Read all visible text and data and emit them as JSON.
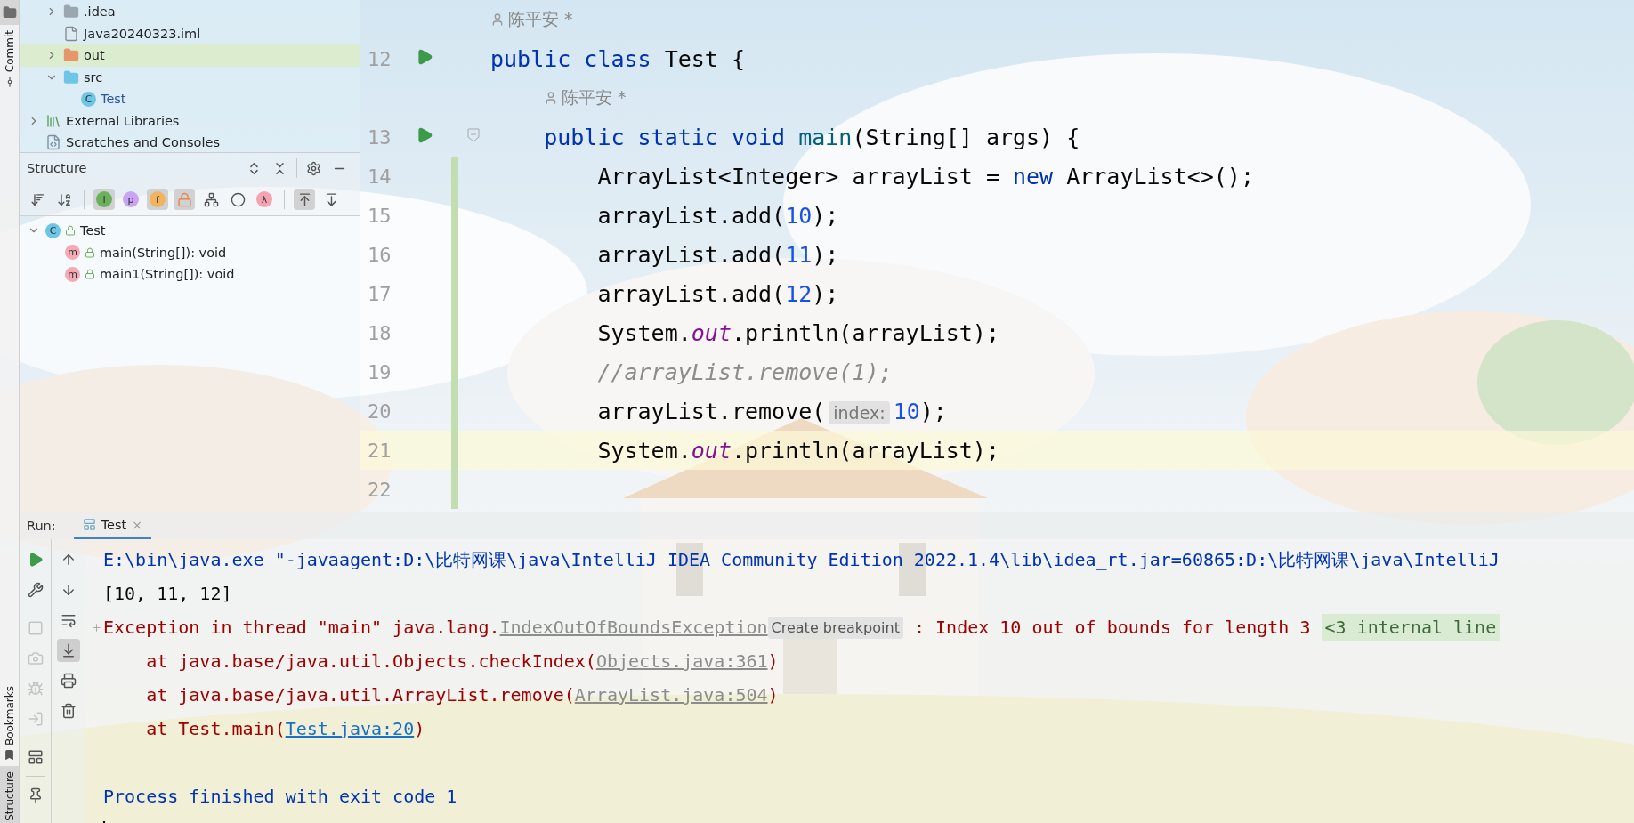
{
  "left_strip": {
    "items": [
      {
        "kind": "project",
        "selected": true
      },
      {
        "kind": "commit",
        "label": "Commit",
        "selected": false
      },
      {
        "kind": "bookmarks",
        "label": "Bookmarks",
        "selected": false
      },
      {
        "kind": "structure",
        "label": "Structure",
        "selected": true
      }
    ]
  },
  "project_tree": {
    "items": [
      {
        "children": [
          {
            "label": ".idea",
            "kind": "folder",
            "expanded": false,
            "selected": false
          },
          {
            "label": "Java20240323.iml",
            "kind": "file",
            "selected": false
          },
          {
            "label": "out",
            "kind": "excluded-folder",
            "expanded": false,
            "selected": true
          },
          {
            "label": "src",
            "kind": "source-folder",
            "expanded": true,
            "selected": false,
            "children": [
              {
                "label": "Test",
                "kind": "class",
                "badge": "C",
                "modified": true,
                "selected": false
              }
            ]
          }
        ]
      },
      {
        "label": "External Libraries",
        "kind": "library",
        "expanded": false,
        "selected": false
      },
      {
        "label": "Scratches and Consoles",
        "kind": "scratch",
        "selected": false
      }
    ]
  },
  "structure": {
    "title": "Structure",
    "header_actions": [
      {
        "kind": "expand-all"
      },
      {
        "kind": "collapse-all"
      },
      {
        "kind": "separator"
      },
      {
        "kind": "settings"
      },
      {
        "kind": "minimize"
      }
    ],
    "toolbar": [
      {
        "kind": "sort-visibility",
        "on": false
      },
      {
        "kind": "sort-alpha",
        "on": false
      },
      {
        "kind": "separator"
      },
      {
        "kind": "badge",
        "label": "I",
        "color": "#6bb05a",
        "on": true
      },
      {
        "kind": "badge",
        "label": "p",
        "color": "#c9a4f2",
        "on": false
      },
      {
        "kind": "badge",
        "label": "f",
        "color": "#f0b45e",
        "on": true
      },
      {
        "kind": "lock",
        "on": true
      },
      {
        "kind": "hierarchy",
        "on": false
      },
      {
        "kind": "anonymous",
        "on": false
      },
      {
        "kind": "badge",
        "label": "λ",
        "color": "#f5a3b0",
        "on": false
      },
      {
        "kind": "separator"
      },
      {
        "kind": "show-inherited",
        "on": true
      },
      {
        "kind": "autoscroll",
        "on": false
      }
    ],
    "tree": [
      {
        "label": "Test",
        "kind": "class",
        "badge": "C",
        "expanded": true,
        "children": [
          {
            "label": "main(String[]): void",
            "kind": "method",
            "badge": "m"
          },
          {
            "label": "main1(String[]): void",
            "kind": "method",
            "badge": "m"
          }
        ]
      }
    ]
  },
  "editor": {
    "lines": [
      {
        "kind": "annotation",
        "nested": false,
        "text": "陈平安 *"
      },
      {
        "kind": "code",
        "number": "12",
        "run": true,
        "fold": false,
        "changed": false,
        "current": false,
        "tokens": [
          {
            "kind": "kw",
            "text": "public class "
          },
          {
            "kind": "plain",
            "text": "Test {"
          }
        ]
      },
      {
        "kind": "annotation",
        "nested": true,
        "text": "陈平安 *"
      },
      {
        "kind": "code",
        "number": "13",
        "run": true,
        "fold": true,
        "changed": false,
        "current": false,
        "tokens": [
          {
            "kind": "kw",
            "text": "    public static void "
          },
          {
            "kind": "method",
            "text": "main"
          },
          {
            "kind": "plain",
            "text": "(String[] args) {"
          }
        ]
      },
      {
        "kind": "code",
        "number": "14",
        "run": false,
        "fold": false,
        "changed": true,
        "current": false,
        "tokens": [
          {
            "kind": "plain",
            "text": "        ArrayList<Integer> arrayList = "
          },
          {
            "kind": "kw",
            "text": "new "
          },
          {
            "kind": "plain",
            "text": "ArrayList<>();"
          }
        ]
      },
      {
        "kind": "code",
        "number": "15",
        "run": false,
        "fold": false,
        "changed": true,
        "current": false,
        "tokens": [
          {
            "kind": "plain",
            "text": "        arrayList.add("
          },
          {
            "kind": "num",
            "text": "10"
          },
          {
            "kind": "plain",
            "text": ");"
          }
        ]
      },
      {
        "kind": "code",
        "number": "16",
        "run": false,
        "fold": false,
        "changed": true,
        "current": false,
        "tokens": [
          {
            "kind": "plain",
            "text": "        arrayList.add("
          },
          {
            "kind": "num",
            "text": "11"
          },
          {
            "kind": "plain",
            "text": ");"
          }
        ]
      },
      {
        "kind": "code",
        "number": "17",
        "run": false,
        "fold": false,
        "changed": true,
        "current": false,
        "tokens": [
          {
            "kind": "plain",
            "text": "        arrayList.add("
          },
          {
            "kind": "num",
            "text": "12"
          },
          {
            "kind": "plain",
            "text": ");"
          }
        ]
      },
      {
        "kind": "code",
        "number": "18",
        "run": false,
        "fold": false,
        "changed": true,
        "current": false,
        "tokens": [
          {
            "kind": "plain",
            "text": "        System."
          },
          {
            "kind": "field",
            "text": "out"
          },
          {
            "kind": "plain",
            "text": ".println(arrayList);"
          }
        ]
      },
      {
        "kind": "code",
        "number": "19",
        "run": false,
        "fold": false,
        "changed": true,
        "current": false,
        "tokens": [
          {
            "kind": "comment",
            "text": "        //arrayList.remove(1);"
          }
        ]
      },
      {
        "kind": "code",
        "number": "20",
        "run": false,
        "fold": false,
        "changed": true,
        "current": false,
        "tokens": [
          {
            "kind": "plain",
            "text": "        arrayList.remove("
          },
          {
            "kind": "hint",
            "text": "index:"
          },
          {
            "kind": "num",
            "text": "10"
          },
          {
            "kind": "plain",
            "text": ");"
          }
        ]
      },
      {
        "kind": "code",
        "number": "21",
        "run": false,
        "fold": false,
        "changed": true,
        "current": true,
        "tokens": [
          {
            "kind": "plain",
            "text": "        System."
          },
          {
            "kind": "field",
            "text": "out"
          },
          {
            "kind": "plain",
            "text": ".println(arrayList);"
          }
        ]
      },
      {
        "kind": "code",
        "number": "22",
        "run": false,
        "fold": false,
        "changed": true,
        "current": false
      }
    ]
  },
  "run": {
    "label": "Run:",
    "tabs": [
      {
        "label": "Test",
        "close": "×",
        "selected": true
      }
    ],
    "toolbar_left": [
      {
        "kind": "rerun",
        "disabled": false
      },
      {
        "kind": "settings",
        "disabled": false
      },
      {
        "kind": "separator"
      },
      {
        "kind": "stop",
        "disabled": true
      },
      {
        "kind": "dump",
        "disabled": true
      },
      {
        "kind": "debug",
        "disabled": true
      },
      {
        "kind": "exit",
        "disabled": true
      },
      {
        "kind": "separator"
      },
      {
        "kind": "layout",
        "disabled": false
      },
      {
        "kind": "separator"
      },
      {
        "kind": "pin",
        "disabled": false
      }
    ],
    "toolbar_right": [
      {
        "kind": "up",
        "on": false
      },
      {
        "kind": "down",
        "on": false
      },
      {
        "kind": "wrap",
        "on": false
      },
      {
        "kind": "scroll-end",
        "on": true
      },
      {
        "kind": "print",
        "on": false
      },
      {
        "kind": "clear",
        "on": false
      }
    ],
    "console": [
      {
        "kind": "text",
        "segments": [
          {
            "kind": "command",
            "text": "E:\\bin\\java.exe \"-javaagent:D:\\比特网课\\java\\IntelliJ IDEA Community Edition 2022.1.4\\lib\\idea_rt.jar=60865:D:\\比特网课\\java\\IntelliJ"
          }
        ]
      },
      {
        "kind": "text",
        "segments": [
          {
            "kind": "output",
            "text": "[10, 11, 12]"
          }
        ]
      },
      {
        "kind": "text",
        "expandable": true,
        "segments": [
          {
            "kind": "error",
            "text": "Exception in thread \"main\" java.lang."
          },
          {
            "kind": "link",
            "text": "IndexOutOfBoundsException"
          },
          {
            "kind": "hint",
            "text": "Create breakpoint"
          },
          {
            "kind": "error",
            "text": " : Index 10 out of bounds for length 3 "
          },
          {
            "kind": "folded",
            "text": "<3 internal line"
          }
        ]
      },
      {
        "kind": "text",
        "segments": [
          {
            "kind": "error",
            "text": "    at java.base/java.util.Objects.checkIndex("
          },
          {
            "kind": "link",
            "text": "Objects.java:361"
          },
          {
            "kind": "error",
            "text": ")"
          }
        ]
      },
      {
        "kind": "text",
        "segments": [
          {
            "kind": "error",
            "text": "    at java.base/java.util.ArrayList.remove("
          },
          {
            "kind": "link",
            "text": "ArrayList.java:504"
          },
          {
            "kind": "error",
            "text": ")"
          }
        ]
      },
      {
        "kind": "text",
        "segments": [
          {
            "kind": "error",
            "text": "    at Test.main("
          },
          {
            "kind": "source",
            "text": "Test.java:20"
          },
          {
            "kind": "error",
            "text": ")"
          }
        ]
      },
      {
        "kind": "blank"
      },
      {
        "kind": "text",
        "segments": [
          {
            "kind": "command",
            "text": "Process finished with exit code 1"
          }
        ]
      },
      {
        "kind": "cursor"
      }
    ]
  }
}
